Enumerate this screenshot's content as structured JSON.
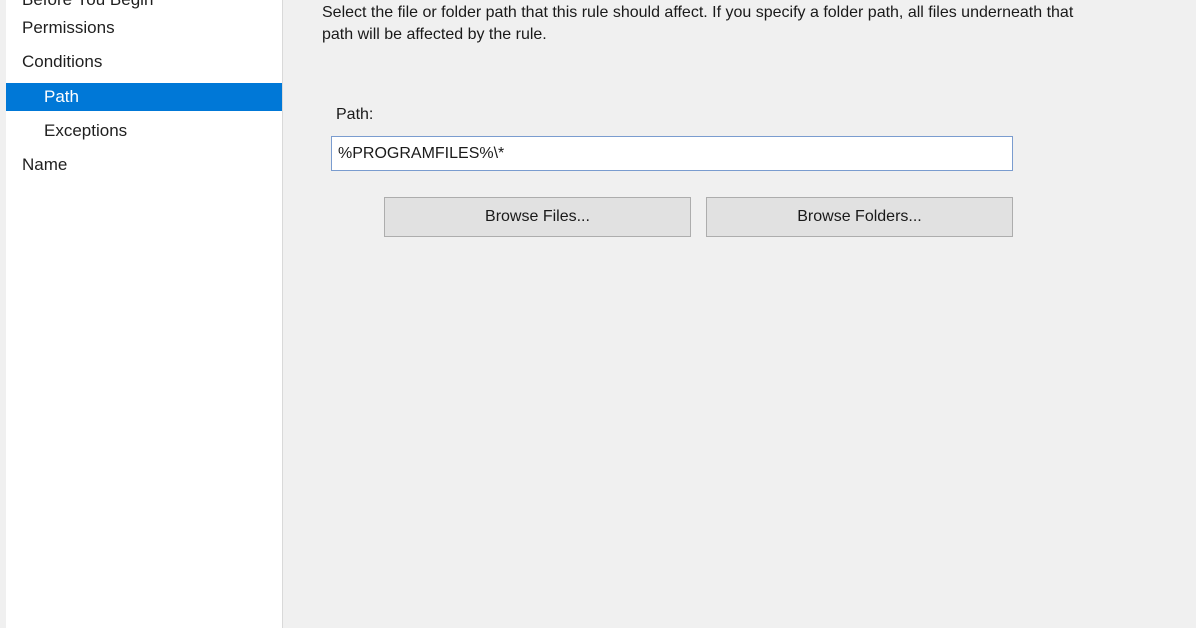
{
  "sidebar": {
    "items": [
      {
        "label": "Before You Begin",
        "level": 0,
        "selected": false
      },
      {
        "label": "Permissions",
        "level": 0,
        "selected": false
      },
      {
        "label": "Conditions",
        "level": 0,
        "selected": false
      },
      {
        "label": "Path",
        "level": 1,
        "selected": true
      },
      {
        "label": "Exceptions",
        "level": 1,
        "selected": false
      },
      {
        "label": "Name",
        "level": 0,
        "selected": false
      }
    ]
  },
  "main": {
    "description": "Select the file or folder path that this rule should affect. If you specify a folder path, all files underneath that path will be affected by the rule.",
    "path_label": "Path:",
    "path_value": "%PROGRAMFILES%\\*",
    "browse_files_label": "Browse Files...",
    "browse_folders_label": "Browse Folders..."
  },
  "colors": {
    "selection": "#0078d7",
    "panel_background": "#f0f0f0",
    "sidebar_background": "#ffffff"
  }
}
